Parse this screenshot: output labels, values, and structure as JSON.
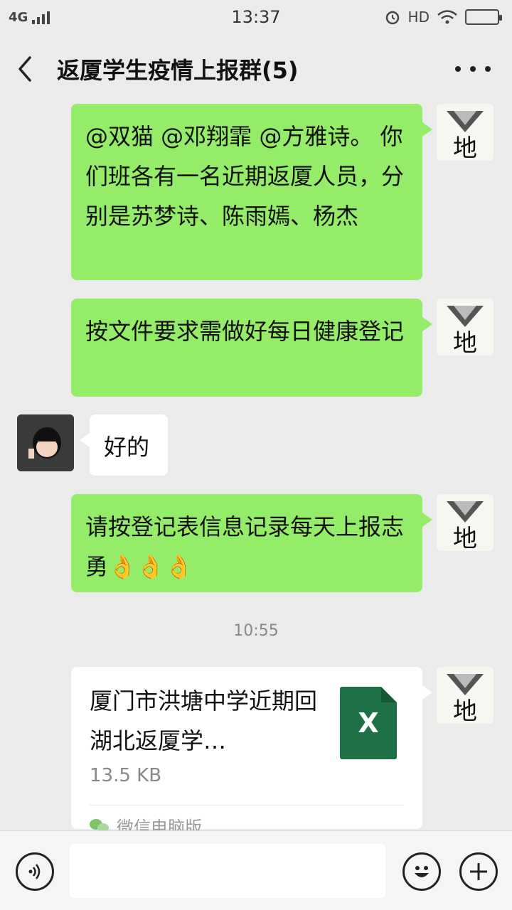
{
  "status_bar": {
    "network": "4G",
    "time": "13:37",
    "hd": "HD"
  },
  "header": {
    "title": "返厦学生疫情上报群(5)"
  },
  "messages": [
    {
      "sender": "me",
      "avatar_text": "地",
      "text": "@双猫 @邓翔霏 @方雅诗。 你们班各有一名近期返厦人员，分别是苏梦诗、陈雨嫣、杨杰"
    },
    {
      "sender": "me",
      "avatar_text": "地",
      "text": "按文件要求需做好每日健康登记"
    },
    {
      "sender": "other",
      "text": "好的"
    },
    {
      "sender": "me",
      "avatar_text": "地",
      "text": "请按登记表信息记录每天上报志勇👌👌👌"
    }
  ],
  "timestamp": "10:55",
  "file_message": {
    "avatar_text": "地",
    "name": "厦门市洪塘中学近期回湖北返厦学…",
    "size": "13.5 KB",
    "icon_letter": "X",
    "source": "微信电脑版"
  },
  "input": {
    "placeholder": ""
  },
  "colors": {
    "my_bubble": "#95ec69",
    "other_bubble": "#ffffff",
    "background": "#ebebeb",
    "excel_green": "#1e7145"
  }
}
